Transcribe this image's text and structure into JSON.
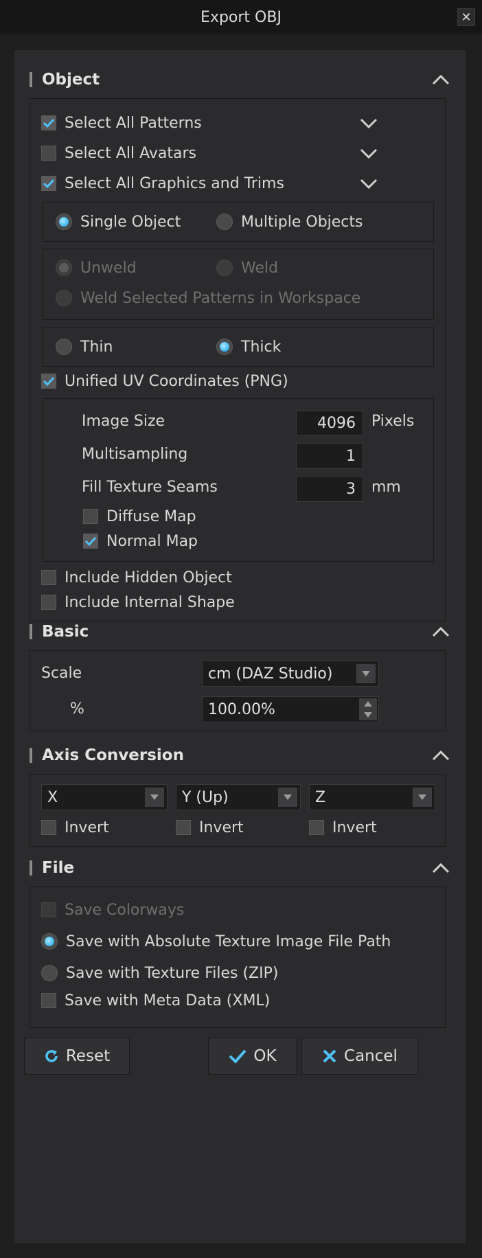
{
  "window": {
    "title": "Export OBJ",
    "close_label": "✕"
  },
  "object": {
    "header": "Object",
    "select_patterns": {
      "label": "Select All Patterns",
      "checked": true
    },
    "select_avatars": {
      "label": "Select All Avatars",
      "checked": false
    },
    "select_graphics": {
      "label": "Select All Graphics and Trims",
      "checked": true
    },
    "object_mode": {
      "single": "Single Object",
      "multiple": "Multiple Objects",
      "selected": "single"
    },
    "weld": {
      "unweld": "Unweld",
      "weld": "Weld",
      "weld_selected": "Weld Selected Patterns in Workspace",
      "selected": "unweld",
      "disabled": true
    },
    "thickness": {
      "thin": "Thin",
      "thick": "Thick",
      "selected": "thick"
    },
    "unified_uv": {
      "label": "Unified UV Coordinates (PNG)",
      "checked": true
    },
    "uv": {
      "image_size_label": "Image Size",
      "image_size_value": "4096",
      "image_size_unit": "Pixels",
      "multisampling_label": "Multisampling",
      "multisampling_value": "1",
      "fill_seams_label": "Fill Texture Seams",
      "fill_seams_value": "3",
      "fill_seams_unit": "mm",
      "diffuse_label": "Diffuse Map",
      "diffuse_checked": false,
      "normal_label": "Normal Map",
      "normal_checked": true
    },
    "include_hidden": {
      "label": "Include Hidden Object",
      "checked": false
    },
    "include_internal": {
      "label": "Include Internal Shape",
      "checked": false
    }
  },
  "basic": {
    "header": "Basic",
    "scale_label": "Scale",
    "scale_value": "cm (DAZ Studio)",
    "percent_label": "%",
    "percent_value": "100.00%"
  },
  "axis": {
    "header": "Axis Conversion",
    "x_value": "X",
    "y_value": "Y (Up)",
    "z_value": "Z",
    "invert_label": "Invert"
  },
  "file": {
    "header": "File",
    "save_colorways": "Save Colorways",
    "save_absolute": "Save with Absolute Texture Image File Path",
    "save_zip": "Save with Texture Files (ZIP)",
    "save_meta": "Save with Meta Data (XML)",
    "selected_option": "absolute"
  },
  "buttons": {
    "reset": "Reset",
    "ok": "OK",
    "cancel": "Cancel"
  },
  "colors": {
    "accent": "#37b4ee",
    "check": "#4fc3f7"
  }
}
